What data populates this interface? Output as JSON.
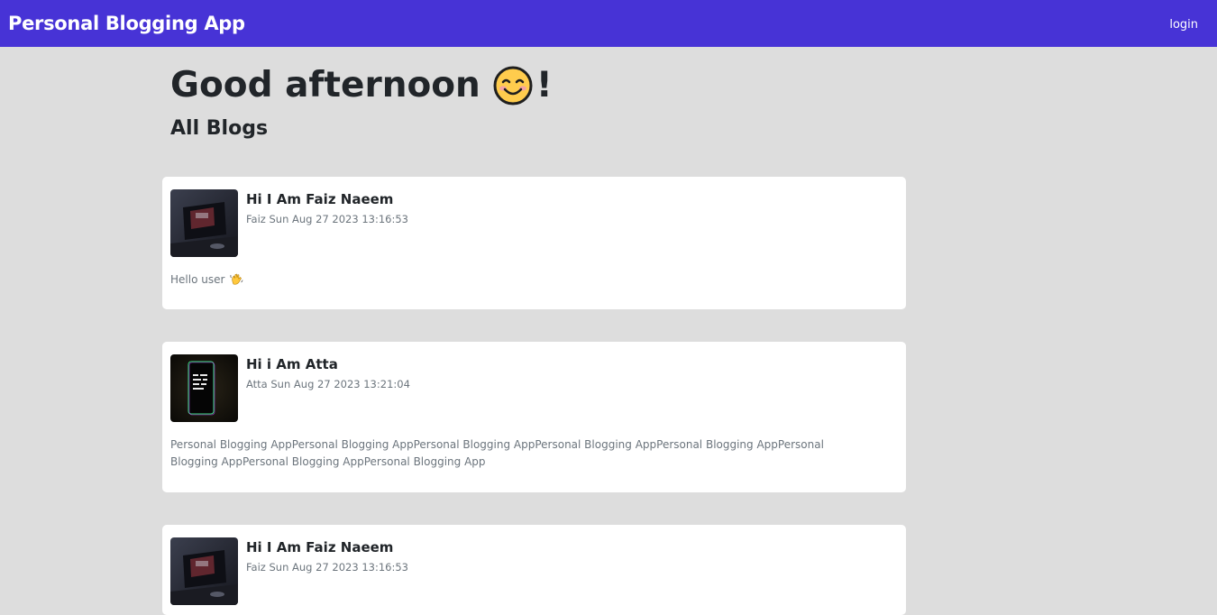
{
  "navbar": {
    "brand": "Personal Blogging App",
    "login_label": "login",
    "color": "#4733d6"
  },
  "greeting": {
    "text": "Good afternoon",
    "emoji": "smiling-face-icon",
    "suffix": "!"
  },
  "section_title": "All Blogs",
  "blogs": [
    {
      "title": "Hi I Am Faiz Naeem",
      "author": "Faiz",
      "date": "Sun Aug 27 2023 13:16:53",
      "meta": "Faiz Sun Aug 27 2023 13:16:53",
      "body": "Hello user",
      "body_emoji": "waving-hand-icon",
      "thumbnail": "laptop-dark-thumbnail"
    },
    {
      "title": "Hi i Am Atta",
      "author": "Atta",
      "date": "Sun Aug 27 2023 13:21:04",
      "meta": "Atta Sun Aug 27 2023 13:21:04",
      "body": "Personal Blogging AppPersonal Blogging AppPersonal Blogging AppPersonal Blogging AppPersonal Blogging AppPersonal Blogging AppPersonal Blogging AppPersonal Blogging App",
      "thumbnail": "phone-neon-thumbnail"
    },
    {
      "title": "Hi I Am Faiz Naeem",
      "author": "Faiz",
      "date": "Sun Aug 27 2023 13:16:53",
      "meta": "Faiz Sun Aug 27 2023 13:16:53",
      "thumbnail": "laptop-dark-thumbnail"
    }
  ]
}
